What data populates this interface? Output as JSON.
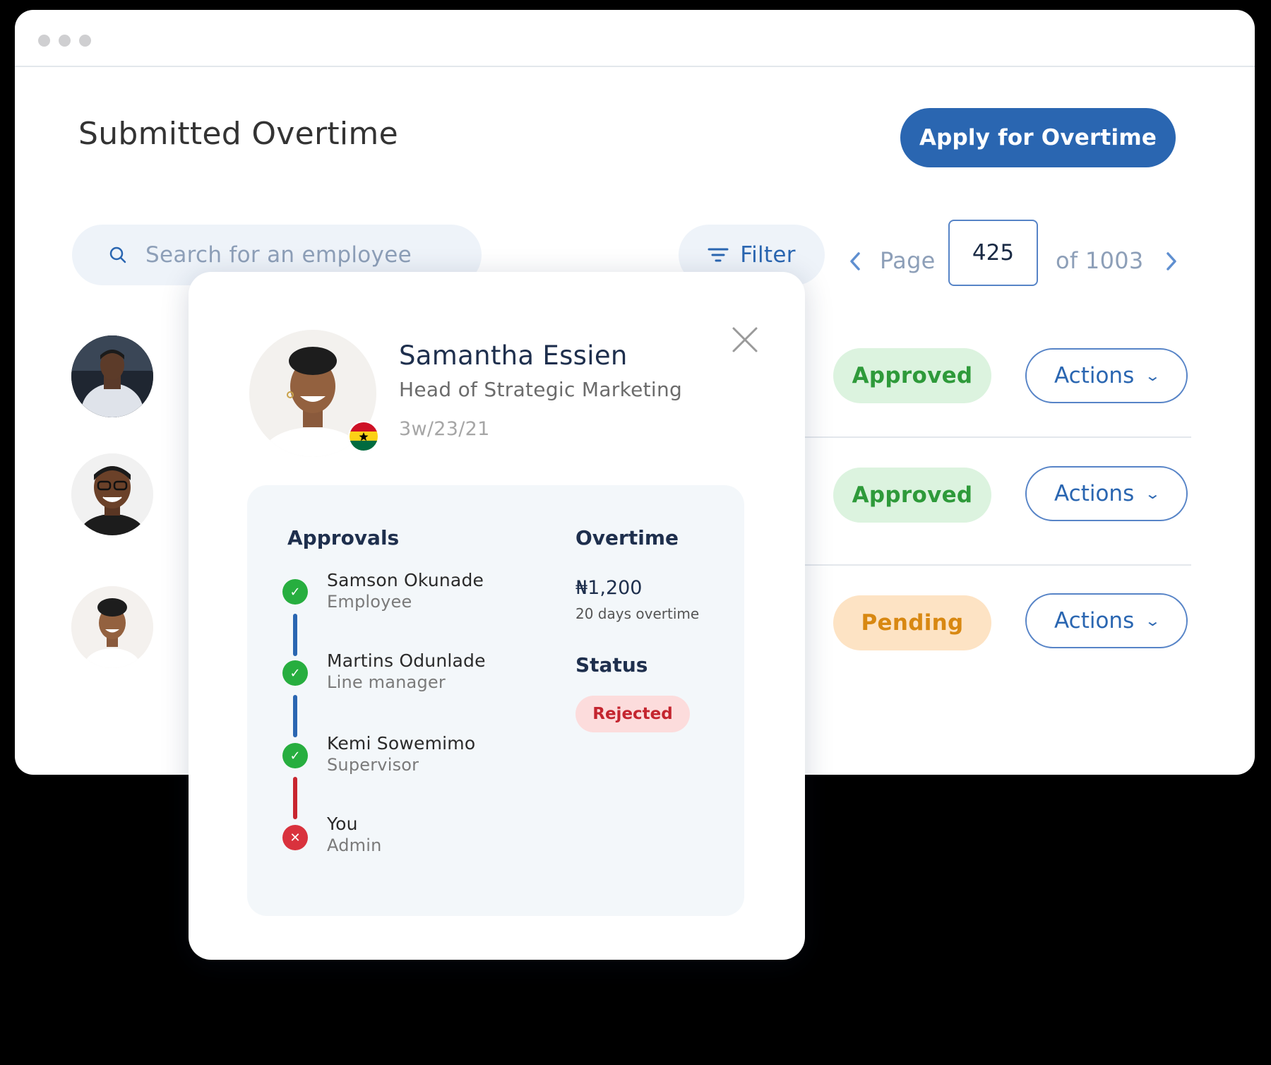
{
  "window": {
    "title": "Submitted Overtime"
  },
  "header": {
    "apply_label": "Apply for Overtime"
  },
  "search": {
    "placeholder": "Search for an employee"
  },
  "filter": {
    "label": "Filter"
  },
  "pagination": {
    "page_label": "Page",
    "current": "425",
    "of_label": "of 1003"
  },
  "rows": [
    {
      "status": "Approved",
      "actions_label": "Actions"
    },
    {
      "status": "Approved",
      "actions_label": "Actions"
    },
    {
      "status": "Pending",
      "actions_label": "Actions"
    }
  ],
  "detail": {
    "name": "Samantha Essien",
    "role": "Head of Strategic Marketing",
    "date": "3w/23/21",
    "approvals_heading": "Approvals",
    "approvals": [
      {
        "name": "Samson Okunade",
        "role": "Employee",
        "state": "approved"
      },
      {
        "name": "Martins Odunlade",
        "role": "Line manager",
        "state": "approved"
      },
      {
        "name": "Kemi Sowemimo",
        "role": "Supervisor",
        "state": "approved"
      },
      {
        "name": "You",
        "role": "Admin",
        "state": "rejected"
      }
    ],
    "overtime_heading": "Overtime",
    "overtime_amount": "₦1,200",
    "overtime_days": "20 days overtime",
    "status_heading": "Status",
    "status_value": "Rejected"
  },
  "colors": {
    "primary": "#2a66b1",
    "approved_bg": "#dcf3df",
    "approved_text": "#2e9a3a",
    "pending_bg": "#fde3c4",
    "pending_text": "#d88812",
    "rejected_bg": "#fcdcdc",
    "rejected_text": "#c4252f"
  },
  "icons": {
    "search": "search-icon",
    "filter": "filter-icon",
    "prev": "chevron-left-icon",
    "next": "chevron-right-icon",
    "close": "close-icon",
    "chevron_down": "chevron-down-icon"
  }
}
